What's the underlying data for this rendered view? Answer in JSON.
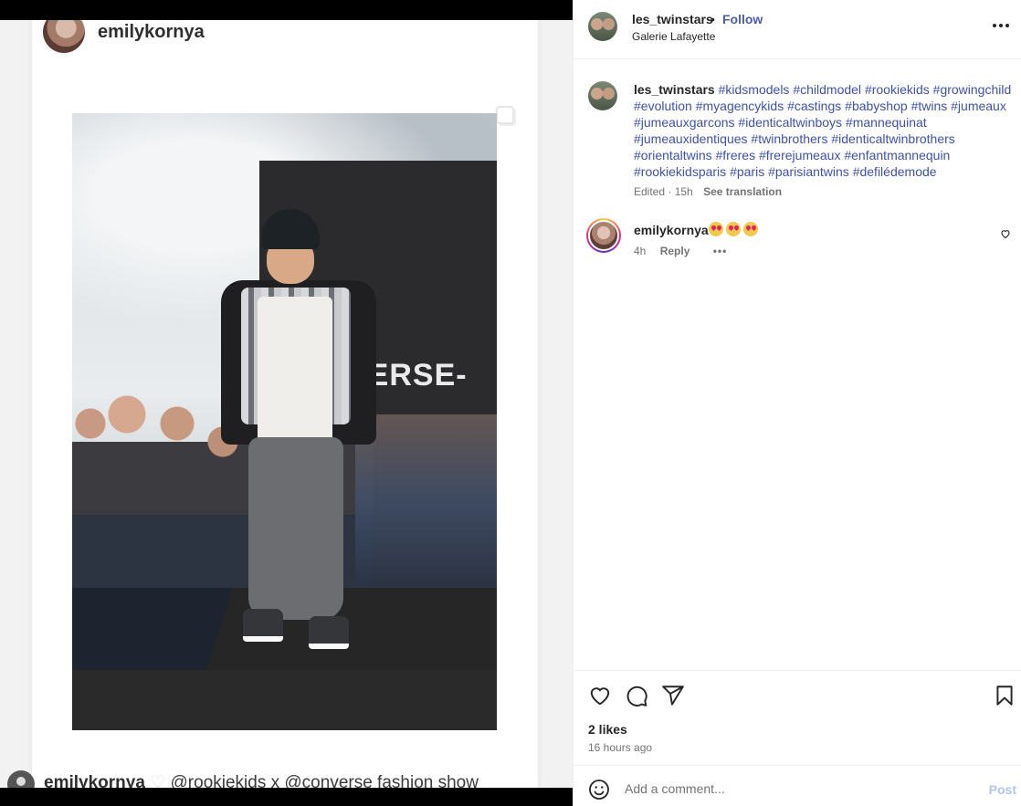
{
  "media": {
    "card_username": "emilykornya",
    "backdrop_text": "VERSE-",
    "caption_user": "emilykornya",
    "caption_text": "@rookiekids x @converse fashion show"
  },
  "header": {
    "username": "les_twinstars",
    "separator": "•",
    "follow_label": "Follow",
    "location": "Galerie Lafayette",
    "more_icon": "more-horizontal-icon"
  },
  "caption": {
    "username": "les_twinstars",
    "hashtags": [
      "#kidsmodels",
      "#childmodel",
      "#rookiekids",
      "#growingchild",
      "#evolution",
      "#myagencykids",
      "#castings",
      "#babyshop",
      "#twins",
      "#jumeaux",
      "#jumeauxgarcons",
      "#identicaltwinboys",
      "#mannequinat",
      "#jumeauxidentiques",
      "#twinbrothers",
      "#identicaltwinbrothers",
      "#orientaltwins",
      "#freres",
      "#frerejumeaux",
      "#enfantmannequin",
      "#rookiekidsparis",
      "#paris",
      "#parisiantwins",
      "#defilédemode"
    ],
    "edited": "Edited · 15h",
    "see_translation": "See translation"
  },
  "comments": [
    {
      "username": "emilykornya",
      "emojis": "😍😍😍",
      "time": "4h",
      "reply_label": "Reply",
      "more": "•••"
    }
  ],
  "actions": {
    "likes": "2 likes",
    "time_ago": "16 hours ago",
    "icons": [
      "heart-icon",
      "comment-icon",
      "share-icon",
      "bookmark-icon"
    ]
  },
  "add_comment": {
    "placeholder": "Add a comment...",
    "post_label": "Post"
  },
  "colors": {
    "link": "#3f51a8",
    "follow": "#4a5ba7",
    "post_disabled": "#b2c5f0",
    "muted": "#737373"
  }
}
